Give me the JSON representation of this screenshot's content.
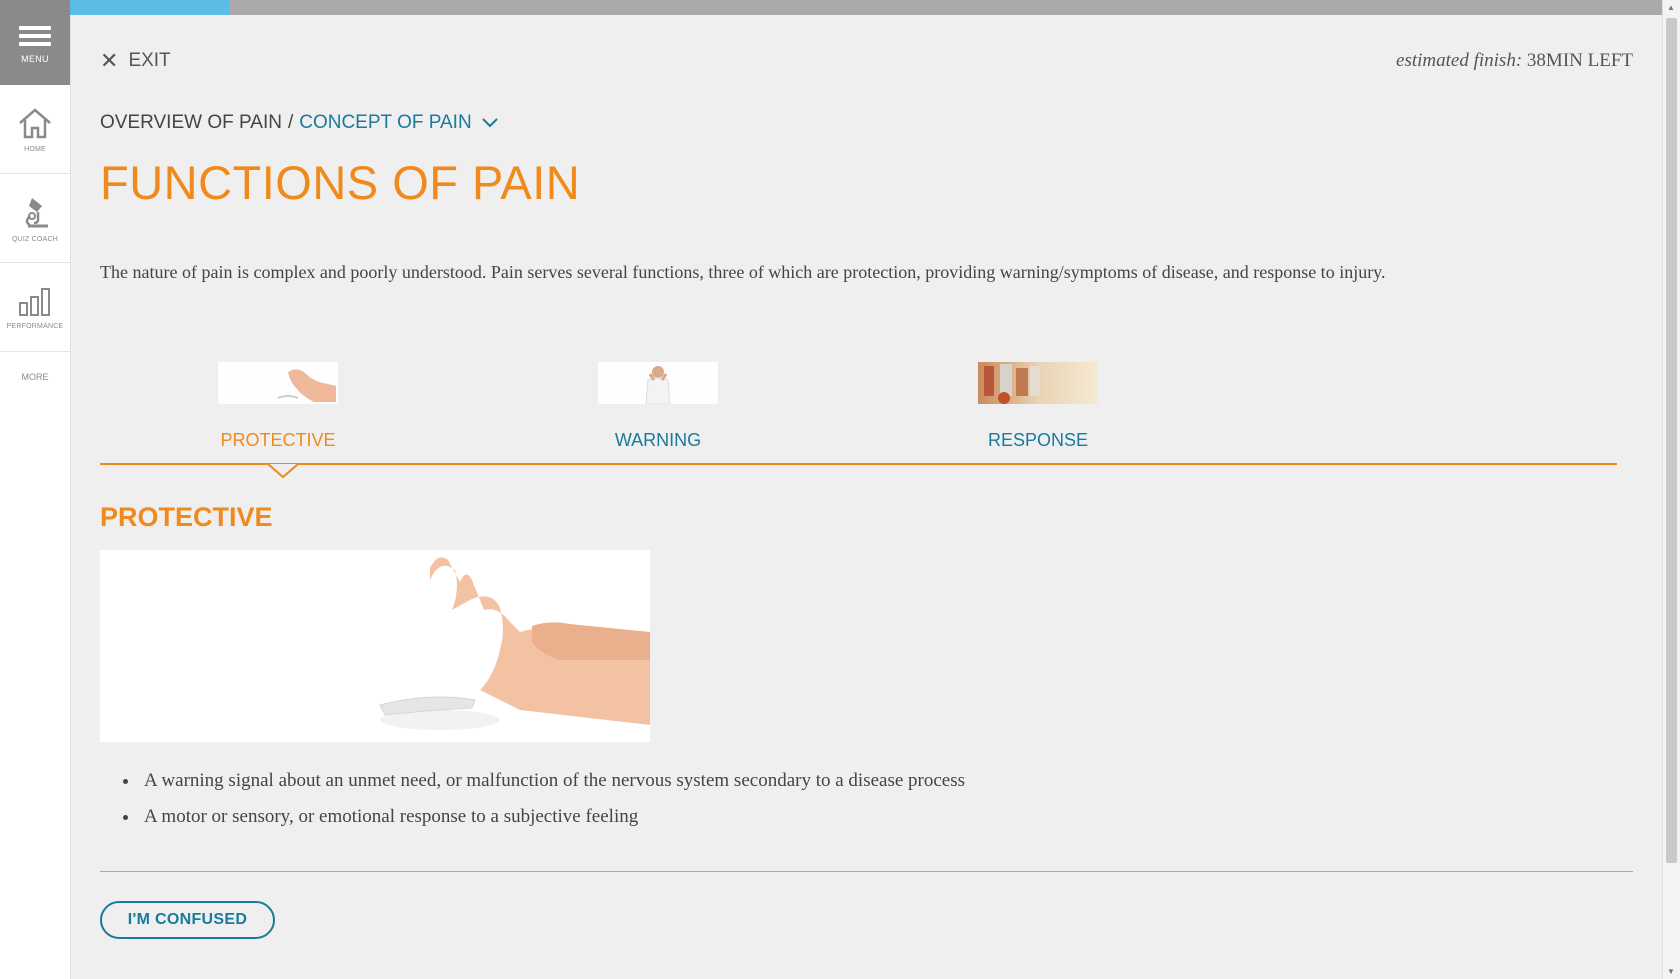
{
  "sidebar": {
    "menu_label": "MENU",
    "items": [
      {
        "label": "HOME",
        "icon": "home-icon"
      },
      {
        "label": "QUIZ COACH",
        "icon": "microscope-icon"
      },
      {
        "label": "PERFORMANCE",
        "icon": "bar-chart-icon"
      }
    ],
    "more_label": "MORE"
  },
  "progress": {
    "fraction": 0.1
  },
  "header": {
    "exit_label": "EXIT",
    "finish_prefix": "estimated finish:",
    "finish_value": "38MIN LEFT"
  },
  "breadcrumb": {
    "parent": "OVERVIEW OF PAIN",
    "separator": "/",
    "current": "CONCEPT OF PAIN"
  },
  "page": {
    "title": "FUNCTIONS OF PAIN",
    "intro": "The nature of pain is complex and poorly understood. Pain serves several functions, three of which are protection, providing warning/symptoms of disease, and response to injury."
  },
  "tabs": [
    {
      "label": "PROTECTIVE",
      "active": true
    },
    {
      "label": "WARNING",
      "active": false
    },
    {
      "label": "RESPONSE",
      "active": false
    }
  ],
  "section": {
    "title": "PROTECTIVE",
    "bullets": [
      "A warning signal about an unmet need, or malfunction of the nervous system secondary to a disease process",
      "A motor or sensory, or emotional response to a subjective feeling"
    ]
  },
  "actions": {
    "confused_label": "I'M CONFUSED"
  },
  "colors": {
    "accent": "#f08a1c",
    "link": "#1a7a9c",
    "progress": "#5bbde6"
  }
}
